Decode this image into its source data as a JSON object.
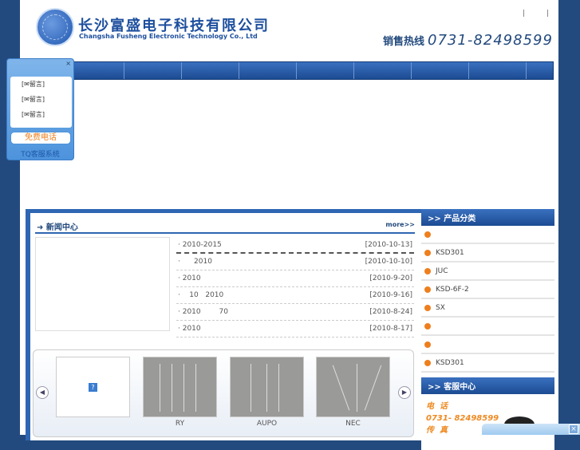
{
  "header": {
    "company_cn": "长沙富盛电子科技有限公司",
    "company_en": "Changsha Fusheng Electronic Technology Co., Ltd",
    "top_links": "| |",
    "hotline_label": "销售热线",
    "hotline": "0731-82498599"
  },
  "tq": {
    "close": "×",
    "rows": [
      "[✉留言]",
      "[✉留言]",
      "[✉留言]"
    ],
    "free_call": "免费电话",
    "label": "TQ客服系统"
  },
  "news": {
    "title": "新闻中心",
    "more": "more>>",
    "items": [
      {
        "title": "· 2010-2015",
        "date": "[2010-10-13]"
      },
      {
        "title": "·      2010",
        "date": "[2010-10-10]"
      },
      {
        "title": "· 2010",
        "date": "[2010-9-20]"
      },
      {
        "title": "·    10   2010",
        "date": "[2010-9-16]"
      },
      {
        "title": "· 2010        70",
        "date": "[2010-8-24]"
      },
      {
        "title": "· 2010",
        "date": "[2010-8-17]"
      }
    ]
  },
  "products": {
    "prev": "◀",
    "next": "▶",
    "missing": "?",
    "items": [
      {
        "caption": "RY"
      },
      {
        "caption": "AUPO"
      },
      {
        "caption": "NEC"
      }
    ]
  },
  "categories": {
    "title": ">> 产品分类",
    "items": [
      "",
      "KSD301",
      "JUC",
      "KSD-6F-2",
      "SX",
      "",
      "",
      "KSD301"
    ]
  },
  "service": {
    "title": ">> 客服中心",
    "phone_label": "电  话",
    "phone": "0731- 82498599",
    "fax_label": "传  真"
  },
  "popup": {
    "close": "×"
  }
}
